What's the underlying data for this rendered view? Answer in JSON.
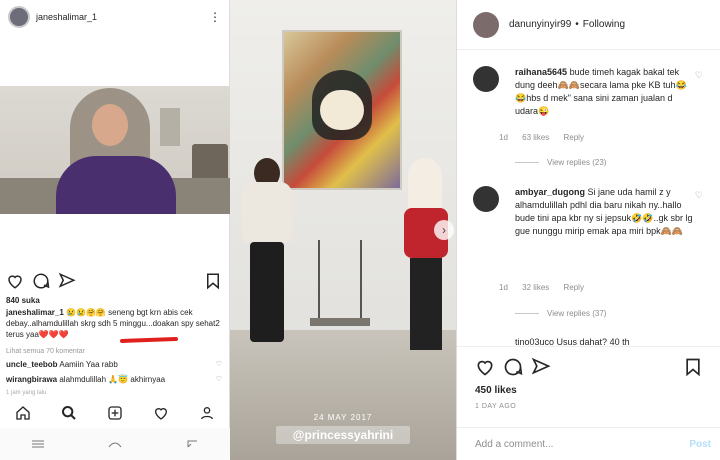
{
  "left": {
    "username": "janeshalimar_1",
    "likes": "840 suka",
    "caption_user": "janeshalimar_1",
    "caption_text": "😢😢🤗🤗 seneng bgt krn abis cek debay..alhamdulillah skrg sdh 5 minggu...doakan spy sehat2 terus yaa❤️❤️❤️",
    "view_all": "Lihat semua 70 komentar",
    "comments": [
      {
        "user": "uncle_teebob",
        "text": "Aamiin Yaa rabb"
      },
      {
        "user": "wirangbirawa",
        "text": "alahmdulillah 🙏😇 akhirnyaa"
      }
    ],
    "time": "1 jam yang lalu"
  },
  "middle": {
    "date": "24 MAY 2017",
    "tag": "@princessyahrini"
  },
  "right": {
    "username": "danunyinyir99",
    "separator": "•",
    "follow_status": "Following",
    "comments": [
      {
        "user": "raihana5645",
        "text": "bude timeh kagak bakal tek dung deeh🙈🙈secara lama pke KB tuh😂😂hbs d mek\" sana sini zaman jualan d udara😜",
        "time": "1d",
        "likes": "63 likes",
        "reply": "Reply",
        "view_replies": "View replies (23)"
      },
      {
        "user": "ambyar_dugong",
        "text": "Si jane uda hamil z y alhamdulillah pdhl dia baru nikah ny..hallo bude tini apa kbr ny si jepsuk🤣🤣..gk sbr lg gue nunggu mirip emak apa miri bpk🙈🙈",
        "time": "1d",
        "likes": "32 likes",
        "reply": "Reply",
        "view_replies": "View replies (37)"
      }
    ],
    "partial_comment": "tino03uco Usus dahat? 40 th",
    "likes": "450 likes",
    "time_ago": "1 DAY AGO",
    "add_comment_placeholder": "Add a comment...",
    "post_label": "Post"
  }
}
